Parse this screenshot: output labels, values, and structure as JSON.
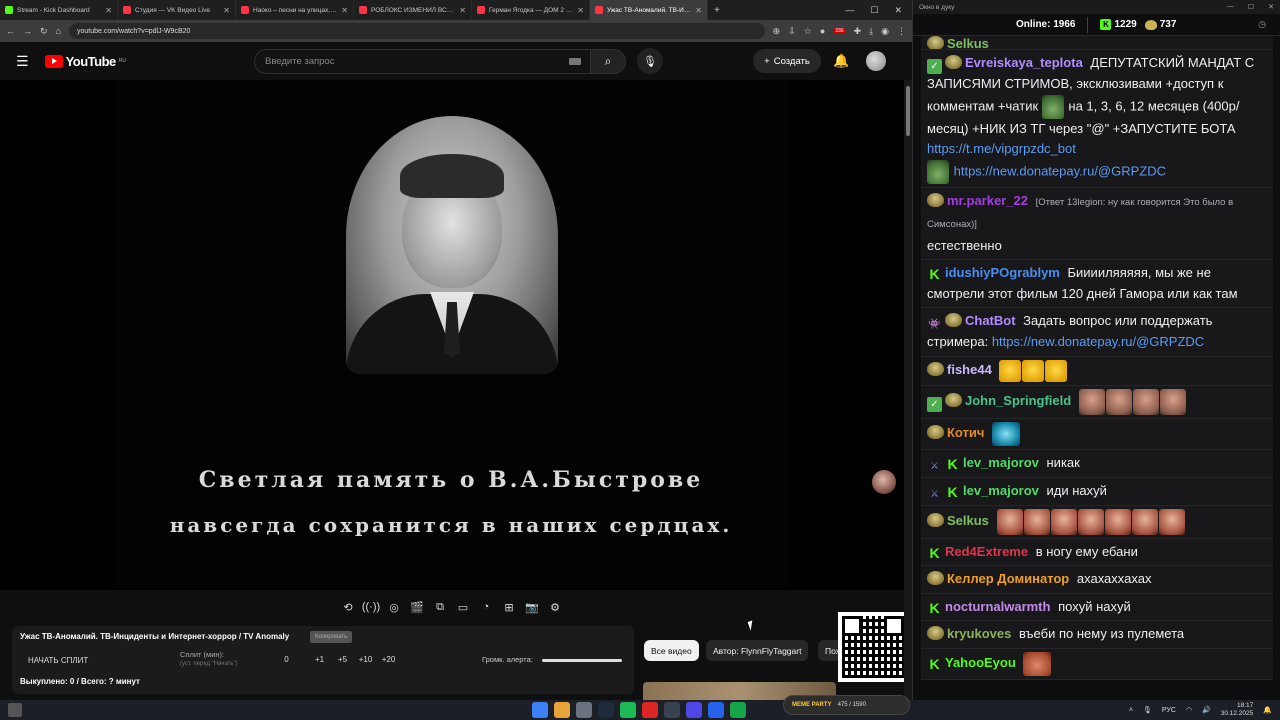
{
  "browser": {
    "tabs": [
      {
        "label": "Stream - Kick Dashboard",
        "color": "#53fc18"
      },
      {
        "label": "Студия — VK Видео Live",
        "color": "#ff3347"
      },
      {
        "label": "Нaoко – песни на улицах, арм",
        "color": "#ff3347"
      },
      {
        "label": "РОБЛОКС ИЗМЕНИЛ ВСЮ МОЮ Ж",
        "color": "#ff3347"
      },
      {
        "label": "Герман Ягодка — ДОМ 2 и ал",
        "color": "#ff3347"
      },
      {
        "label": "Ужас ТВ-Аномалий. ТВ-Инциде",
        "color": "#ff3347"
      }
    ],
    "url": "youtube.com/watch?v=pdlJ-W9cB20",
    "badge": "336"
  },
  "youtube": {
    "logo_text": "YouTube",
    "region": "RU",
    "search_placeholder": "Введите запрос",
    "create_label": "Создать"
  },
  "video": {
    "subtitle_line1": "Светлая память о В.А.Быстрове",
    "subtitle_line2": "навсегда сохранится в наших сердцах."
  },
  "panel": {
    "title": "Ужас ТВ-Аномалий. ТВ-Инциденты и Интернет-хоррор / TV Anomaly",
    "copy_label": "Копировать",
    "split_button": "НАЧАТЬ СПЛИТ",
    "split_label": "Сплит (мин):",
    "split_hint": "(уст. перед \"Начать\")",
    "split_values": [
      "0",
      "+1",
      "+5",
      "+10",
      "+20"
    ],
    "alert_label": "Громк. алерта:",
    "bought": "Выкуплено: 0 / Всего: ? минут"
  },
  "chips": {
    "all": "Все видео",
    "author": "Автор: FlynnFlyTaggart",
    "more": "Пох"
  },
  "chat": {
    "window_title": "Окно в дуку",
    "online_label": "Online:",
    "online_count": "1966",
    "kick_count": "1229",
    "other_count": "737",
    "messages": [
      {
        "nick": "Selkus",
        "color": "#7fbf5f",
        "text": ""
      },
      {
        "nick": "Evreiskaya_teplota",
        "color": "#b18cff",
        "text": "ДЕПУТАТСКИЙ МАНДАТ С ЗАПИСЯМИ СТРИМОВ, эксклюзивами +доступ к комментам +чатик",
        "text2": "на 1, 3, 6, 12 месяцев (400р/месяц) +НИК ИЗ ТГ через \"@\" +ЗАПУСТИТЕ БОТА",
        "link1": "https://t.me/vipgrpzdc_bot",
        "link2": "https://new.donatepay.ru/@GRPZDC"
      },
      {
        "nick": "mr.parker_22",
        "color": "#a43de0",
        "reply": "[Ответ 13legion: ну как  говорится  Это было в  Симсонах)]",
        "text": "естественно"
      },
      {
        "nick": "idushiyPOgrablym",
        "color": "#4a8cf2",
        "text": "Бииииляяяяя, мы же не смотрели этот фильм 120 дней Гамора или как там"
      },
      {
        "nick": "ChatBot",
        "color": "#b18cff",
        "text": "Задать вопрос или поддержать стримера:",
        "link1": "https://new.donatepay.ru/@GRPZDC"
      },
      {
        "nick": "fishe44",
        "color": "#c7b8ff",
        "text": ""
      },
      {
        "nick": "John_Springfield",
        "color": "#4cc38a",
        "text": ""
      },
      {
        "nick": "Котич",
        "color": "#e08a2a",
        "text": ""
      },
      {
        "nick": "lev_majorov",
        "color": "#53d96b",
        "text": "никак"
      },
      {
        "nick": "lev_majorov",
        "color": "#53d96b",
        "text": "иди нахуй"
      },
      {
        "nick": "Selkus",
        "color": "#7fbf5f",
        "text": ""
      },
      {
        "nick": "Red4Extreme",
        "color": "#e0334f",
        "text": "в ногу ему ебани"
      },
      {
        "nick": "Келлер Доминатор",
        "color": "#f0a020",
        "text": "ахахаххахах"
      },
      {
        "nick": "nocturnalwarmth",
        "color": "#c48ae8",
        "text": "похуй нахуй"
      },
      {
        "nick": "kryukoves",
        "color": "#8fb05a",
        "text": "въеби по нему из пулемета"
      },
      {
        "nick": "YahooEyou",
        "color": "#53fc18",
        "text": ""
      }
    ]
  },
  "taskbar": {
    "widget_title": "MEME PARTY",
    "widget_value": "475 / 1590",
    "lang": "РУС",
    "time": "18:17",
    "date": "30.12.2025"
  }
}
